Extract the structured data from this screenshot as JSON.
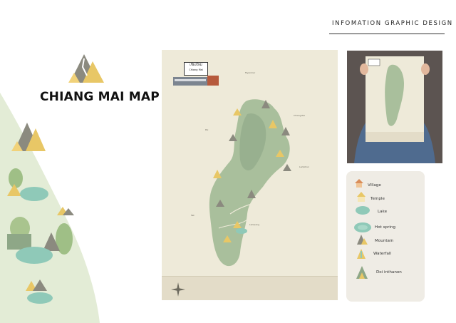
{
  "header": {
    "title": "INFOMATION GRAPHIC DESIGN"
  },
  "page": {
    "title": "CHIANG MAI MAP"
  },
  "poster": {
    "logo_thai": "เชียงใหม่",
    "logo_latin": "Chiang Mai",
    "map_labels": [
      "Myanmar",
      "Pai",
      "Chiang Rai",
      "Lamphun",
      "Lampang",
      "Tak"
    ]
  },
  "legend": {
    "items": [
      {
        "label": "Village",
        "icon": "village-icon"
      },
      {
        "label": "Temple",
        "icon": "temple-icon"
      },
      {
        "label": "Lake",
        "icon": "lake-icon"
      },
      {
        "label": "Hot spring",
        "icon": "hot-spring-icon"
      },
      {
        "label": "Mountain",
        "icon": "mountain-icon"
      },
      {
        "label": "Waterfall",
        "icon": "waterfall-icon"
      },
      {
        "label": "Doi inthanon",
        "icon": "doi-inthanon-icon"
      }
    ]
  },
  "colors": {
    "map_green": "#a9bf9c",
    "map_dark": "#8ea787",
    "poster_bg": "#eeead9",
    "mountain_yellow": "#e8c766",
    "mountain_grey": "#8b8a7f",
    "lake_teal": "#8fc9b8",
    "panel_bg": "#efece5"
  }
}
